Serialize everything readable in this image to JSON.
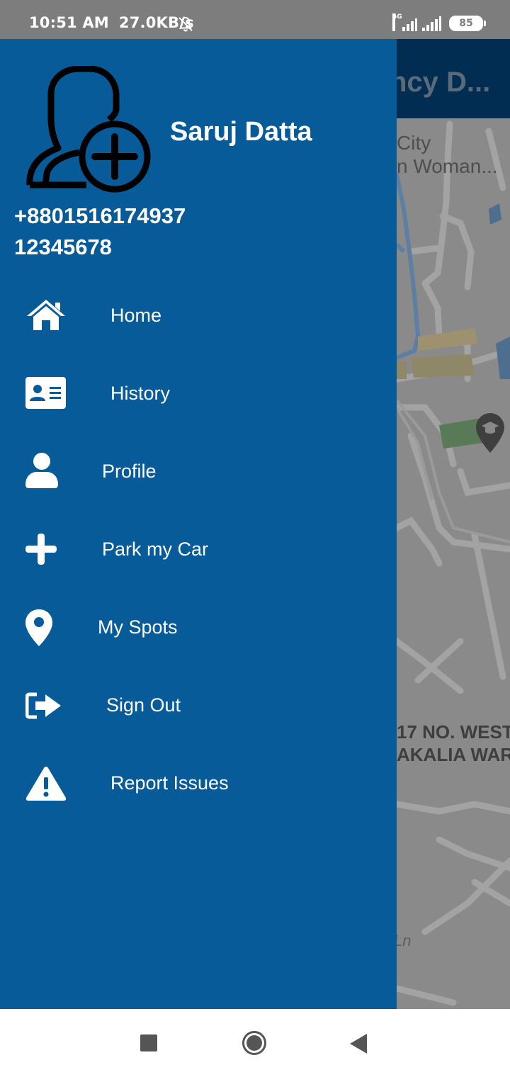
{
  "status_bar": {
    "time": "10:51 AM",
    "speed": "27.0KB/s",
    "mute_icon": "bell-off-icon",
    "network_label": "4G",
    "battery": "85"
  },
  "background_app": {
    "title_fragment": "ncy D...",
    "map_label_city_1": "City",
    "map_label_city_2": "n Woman...",
    "map_label_ward_1": "17 NO. WEST",
    "map_label_ward_2": "AKALIA WARD",
    "map_label_road": "Ln",
    "map_pin_icon": "graduation-cap-pin-icon"
  },
  "drawer": {
    "avatar_icon": "add-user-icon",
    "user_name": "Saruj Datta",
    "user_phone": "+8801516174937",
    "user_id": "12345678",
    "items": [
      {
        "label": "Home",
        "icon": "home-icon"
      },
      {
        "label": "History",
        "icon": "id-card-icon"
      },
      {
        "label": "Profile",
        "icon": "user-icon"
      },
      {
        "label": "Park my Car",
        "icon": "plus-icon"
      },
      {
        "label": "My Spots",
        "icon": "map-pin-icon"
      },
      {
        "label": "Sign Out",
        "icon": "sign-out-icon"
      },
      {
        "label": "Report Issues",
        "icon": "warning-icon"
      }
    ]
  },
  "nav_bar": {
    "recents_icon": "square-icon",
    "home_icon": "circle-icon",
    "back_icon": "triangle-back-icon"
  },
  "colors": {
    "drawer": "#065b98",
    "appbar": "#022d52",
    "status_bar": "#7d7d7d"
  }
}
